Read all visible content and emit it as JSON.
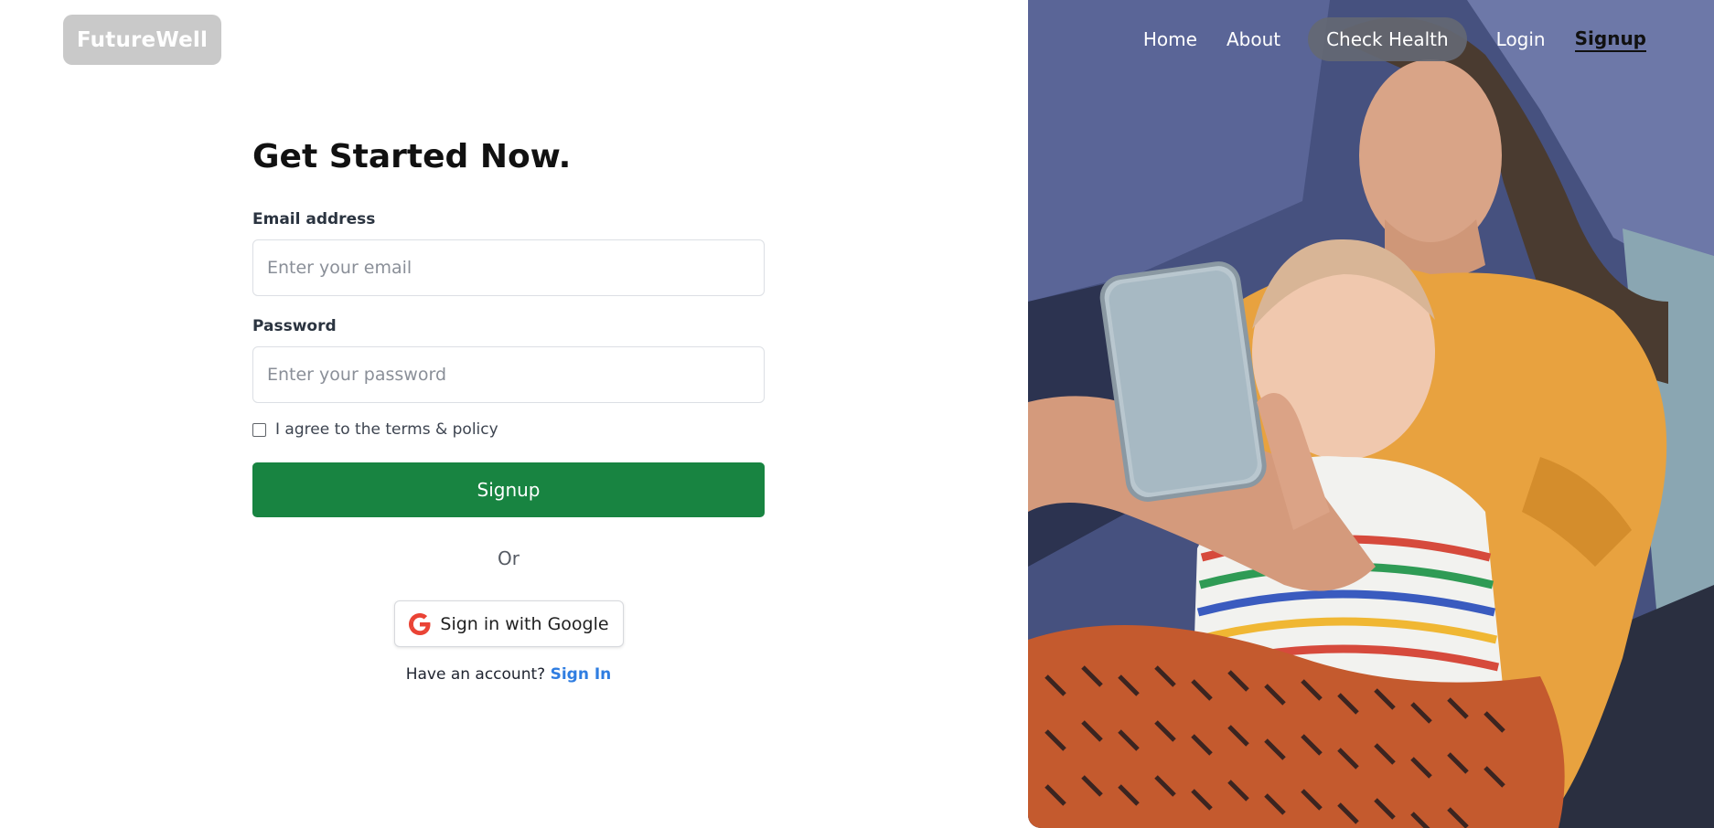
{
  "brand": {
    "name": "FutureWell"
  },
  "nav": {
    "home": "Home",
    "about": "About",
    "check_health": "Check Health",
    "login": "Login",
    "signup": "Signup",
    "active": "signup"
  },
  "form": {
    "heading": "Get Started Now.",
    "email_label": "Email address",
    "email_placeholder": "Enter your email",
    "password_label": "Password",
    "password_placeholder": "Enter your password",
    "agree_text": "I agree to the terms & policy",
    "agree_checked": false,
    "submit_label": "Signup",
    "or_text": "Or",
    "google_label": "Sign in with Google",
    "have_account_text": "Have an account?",
    "signin_link": "Sign In"
  },
  "icons": {
    "google": "google-g-icon",
    "checkbox": "checkbox-unchecked-icon"
  },
  "colors": {
    "primary": "#188441",
    "link": "#2f7de1",
    "logo_bg": "#c9c9c9",
    "nav_pill_bg": "#646873"
  }
}
